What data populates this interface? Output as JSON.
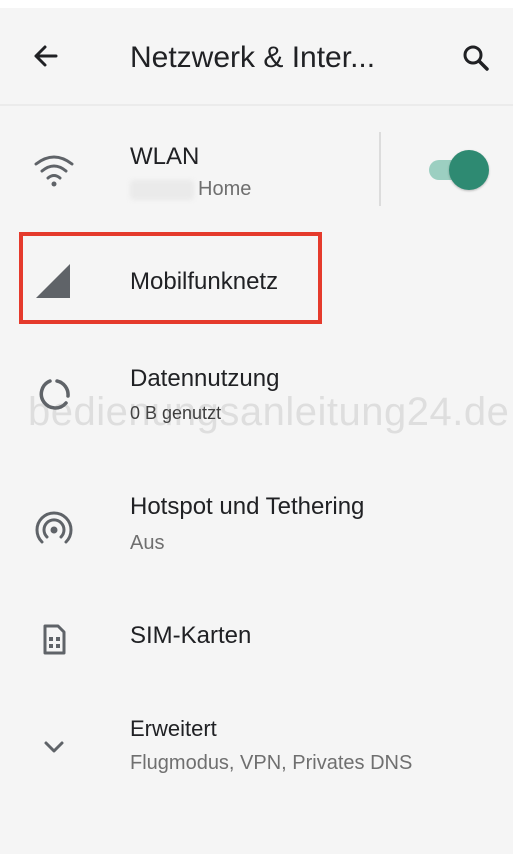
{
  "header": {
    "back_icon": "arrow-left-icon",
    "title": "Netzwerk & Inter...",
    "search_icon": "search-icon"
  },
  "settings": {
    "wlan": {
      "icon": "wifi-icon",
      "label": "WLAN",
      "subtitle": "Home",
      "toggle_state": "on",
      "accent": "#2e8a72"
    },
    "mobile": {
      "icon": "cellular-signal-icon",
      "label": "Mobilfunknetz",
      "highlight_color": "#e53a2c"
    },
    "data_usage": {
      "icon": "data-usage-icon",
      "label": "Datennutzung",
      "subtitle": "0 B genutzt"
    },
    "hotspot": {
      "icon": "hotspot-icon",
      "label": "Hotspot und Tethering",
      "subtitle": "Aus"
    },
    "sim": {
      "icon": "sim-card-icon",
      "label": "SIM-Karten"
    },
    "advanced": {
      "icon": "chevron-down-icon",
      "label": "Erweitert",
      "subtitle": "Flugmodus, VPN, Privates DNS"
    }
  },
  "watermark": "bedienungsanleitung24.de"
}
